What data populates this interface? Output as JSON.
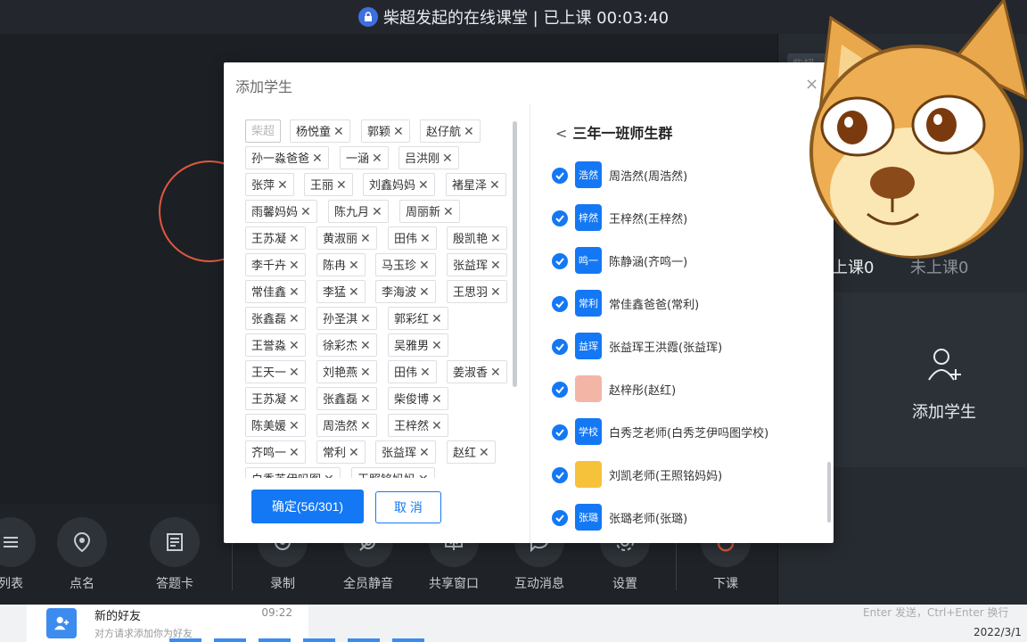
{
  "header": {
    "title": "柴超发起的在线课堂 | 已上课 00:03:40"
  },
  "right_panel": {
    "tag_label": "柴超",
    "stats": [
      "上课0",
      "未上课0"
    ],
    "add_student_label": "添加学生"
  },
  "toolbar": {
    "items": [
      "列表",
      "点名",
      "答题卡",
      "录制",
      "全员静音",
      "共享窗口",
      "互动消息",
      "设置",
      "下课"
    ]
  },
  "dialog": {
    "title": "添加学生",
    "close_symbol": "×",
    "selected_tags": [
      "柴超",
      "杨悦童",
      "郭颖",
      "赵仔航",
      "孙一淼爸爸",
      "一涵",
      "吕洪刚",
      "张萍",
      "王丽",
      "刘鑫妈妈",
      "褚星泽",
      "雨馨妈妈",
      "陈九月",
      "周丽新",
      "王苏凝",
      "黄淑丽",
      "田伟",
      "殷凯艳",
      "李千卉",
      "陈冉",
      "马玉珍",
      "张益珲",
      "常佳鑫",
      "李猛",
      "李海波",
      "王思羽",
      "张鑫磊",
      "孙圣淇",
      "郭彩红",
      "王誉淼",
      "徐彩杰",
      "吴雅男",
      "王天一",
      "刘艳燕",
      "田伟",
      "姜淑香",
      "王苏凝",
      "张鑫磊",
      "柴俊博",
      "陈美媛",
      "周浩然",
      "王梓然",
      "齐鸣一",
      "常利",
      "张益珲",
      "赵红",
      "白秀芝伊吗图",
      "王照铭妈妈"
    ],
    "remove_symbol": "✕",
    "confirm_label": "确定(56/301)",
    "cancel_label": "取 消",
    "group": {
      "back_symbol": "<",
      "title": "三年一班师生群",
      "members": [
        {
          "avatar": "浩然",
          "name": "周浩然(周浩然)"
        },
        {
          "avatar": "梓然",
          "name": "王梓然(王梓然)"
        },
        {
          "avatar": "鸣一",
          "name": "陈静涵(齐鸣一)"
        },
        {
          "avatar": "常利",
          "name": "常佳鑫爸爸(常利)"
        },
        {
          "avatar": "益珲",
          "name": "张益珲王洪霞(张益珲)"
        },
        {
          "avatar": "",
          "name": "赵梓彤(赵红)"
        },
        {
          "avatar": "学校",
          "name": "白秀芝老师(白秀芝伊吗图学校)"
        },
        {
          "avatar": "",
          "name": "刘凯老师(王照铭妈妈)"
        },
        {
          "avatar": "张璐",
          "name": "张璐老师(张璐)"
        }
      ]
    }
  },
  "taskbar": {
    "chat_name": "新的好友",
    "chat_time": "09:22",
    "chat_preview": "对方请求添加你为好友",
    "input_hint": "Enter 发送，Ctrl+Enter 换行",
    "date": "2022/3/1"
  },
  "colors": {
    "accent": "#1478f5",
    "dark_bg": "#1e2227",
    "ring": "#e2573f"
  },
  "icons": [
    "lock-icon",
    "roll-call-icon",
    "answer-card-icon",
    "record-icon",
    "mute-all-icon",
    "share-window-icon",
    "message-icon",
    "settings-icon",
    "end-class-icon",
    "add-user-icon",
    "check-icon",
    "doge-sticker"
  ]
}
